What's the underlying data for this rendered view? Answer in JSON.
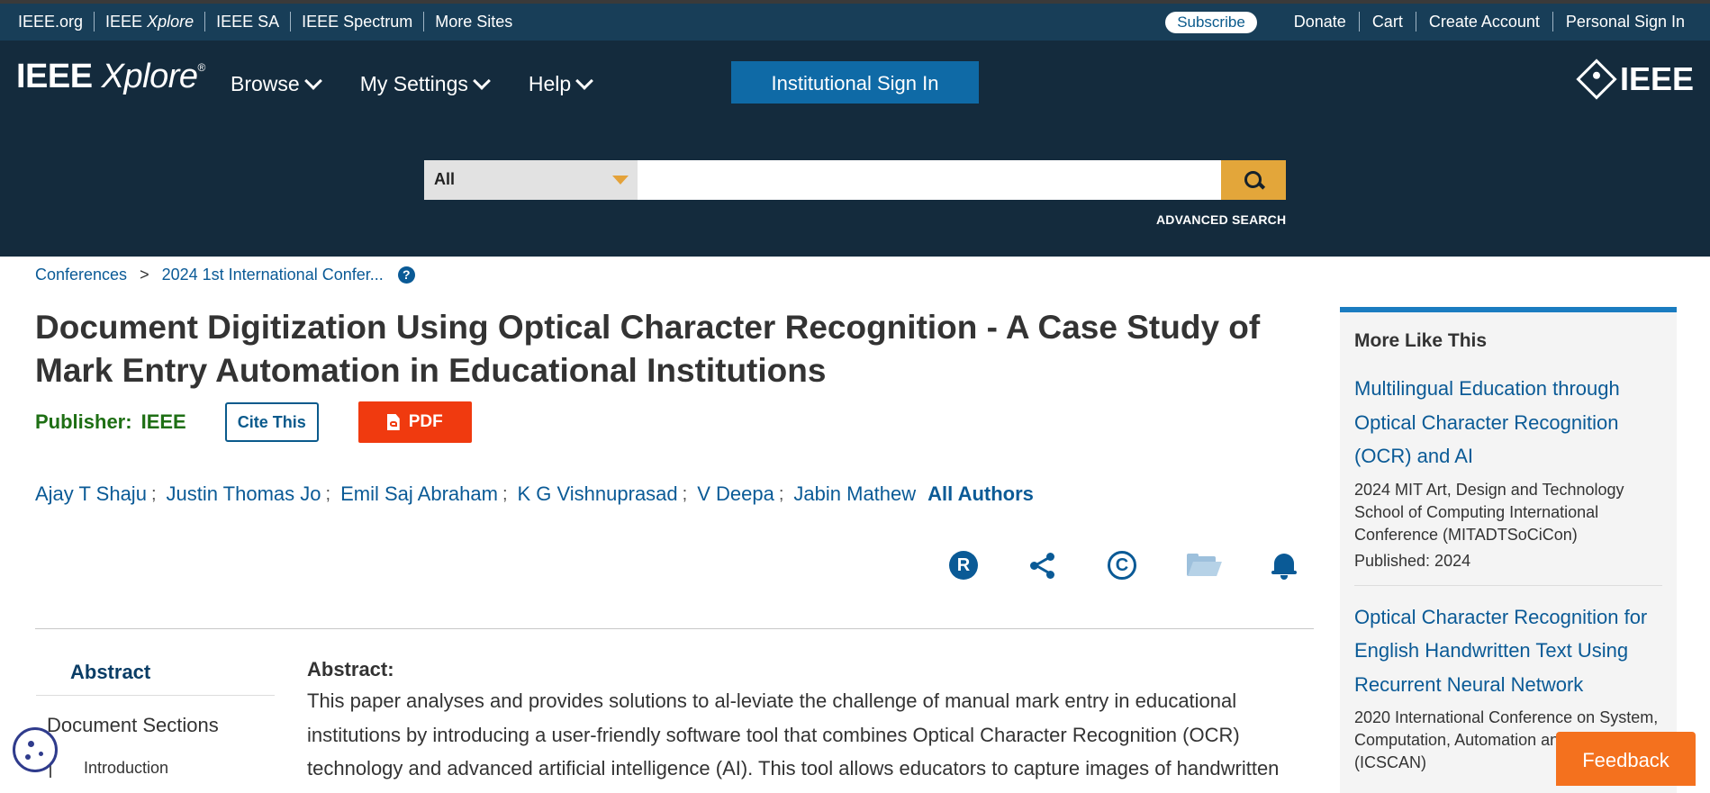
{
  "topbar": {
    "links": [
      "IEEE.org",
      "IEEE",
      "Xplore",
      "IEEE SA",
      "IEEE Spectrum",
      "More Sites"
    ],
    "subscribe": "Subscribe",
    "account": [
      "Donate",
      "Cart",
      "Create Account",
      "Personal Sign In"
    ]
  },
  "header": {
    "logo_main": "IEEE",
    "logo_italic": "Xplore",
    "logo_reg": "®",
    "nav": [
      "Browse",
      "My Settings",
      "Help"
    ],
    "institutional_sign_in": "Institutional Sign In",
    "brand_mark": "IEEE"
  },
  "search": {
    "scope": "All",
    "placeholder": "",
    "advanced": "ADVANCED SEARCH"
  },
  "breadcrumb": {
    "items": [
      "Conferences",
      "2024 1st International Confer..."
    ],
    "separator": ">",
    "help_glyph": "?"
  },
  "article": {
    "title": "Document Digitization Using Optical Character Recognition - A Case Study of Mark Entry Automation in Educational Institutions",
    "publisher_label": "Publisher:",
    "publisher": "IEEE",
    "cite_label": "Cite This",
    "pdf_label": "PDF",
    "authors": [
      "Ajay T Shaju",
      "Justin Thomas Jo",
      "Emil Saj Abraham",
      "K G Vishnuprasad",
      "V Deepa",
      "Jabin Mathew"
    ],
    "author_separator": ";",
    "all_authors": "All Authors",
    "action_icons": [
      "rights-icon",
      "share-icon",
      "copyright-icon",
      "folder-icon",
      "bell-icon"
    ],
    "icon_glyphs": {
      "rights": "R",
      "copyright": "C"
    }
  },
  "sidenav": {
    "abstract": "Abstract",
    "document_sections": "Document Sections",
    "first_section": "Introduction"
  },
  "abstract": {
    "heading": "Abstract:",
    "text": "This paper analyses and provides solutions to al-leviate the challenge of manual mark entry in educational institutions by introducing a user-friendly software tool that combines Optical Character Recognition (OCR) technology and advanced artificial intelligence (AI). This tool allows educators to capture images of handwritten"
  },
  "more_like_this": {
    "heading": "More Like This",
    "items": [
      {
        "title": "Multilingual Education through Optical Character Recognition (OCR) and AI",
        "conference": "2024 MIT Art, Design and Technology School of Computing International Conference (MITADTSoCiCon)",
        "published": "Published: 2024"
      },
      {
        "title": "Optical Character Recognition for English Handwritten Text Using Recurrent Neural Network",
        "conference": "2020 International Conference on System, Computation, Automation and Networking (ICSCAN)",
        "published": ""
      }
    ]
  },
  "feedback": "Feedback",
  "colors": {
    "topbar": "#183e58",
    "header": "#142b3d",
    "link": "#0a5a96",
    "publisher_green": "#1e6f14",
    "pdf_red": "#f03a0f",
    "search_gold": "#e3a63a",
    "feedback_orange": "#f4711e",
    "panel_accent": "#1a7cc0"
  }
}
